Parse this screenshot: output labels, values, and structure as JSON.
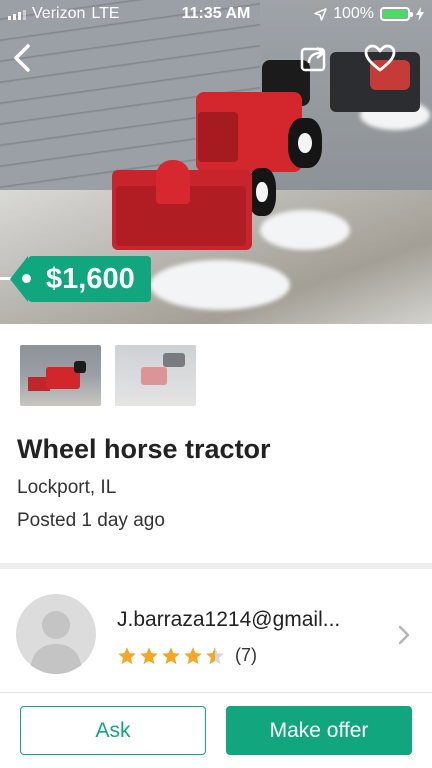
{
  "status_bar": {
    "carrier": "Verizon",
    "network": "LTE",
    "time": "11:35 AM",
    "battery": "100%",
    "battery_level": 1.0,
    "battery_color": "#4cd964"
  },
  "header": {
    "back_icon": "chevron-left-icon",
    "share_icon": "share-icon",
    "favorite_icon": "heart-outline-icon"
  },
  "listing": {
    "price": "$1,600",
    "title": "Wheel horse tractor",
    "location": "Lockport, IL",
    "posted": "Posted 1 day ago",
    "thumbnail_count": 2
  },
  "seller": {
    "name": "J.barraza1214@gmail...",
    "rating_stars": 4.5,
    "review_count": "(7)",
    "avatar_icon": "person-placeholder-icon"
  },
  "actions": {
    "ask_label": "Ask",
    "offer_label": "Make offer"
  },
  "colors": {
    "accent": "#12a67e",
    "star": "#f5a623"
  }
}
